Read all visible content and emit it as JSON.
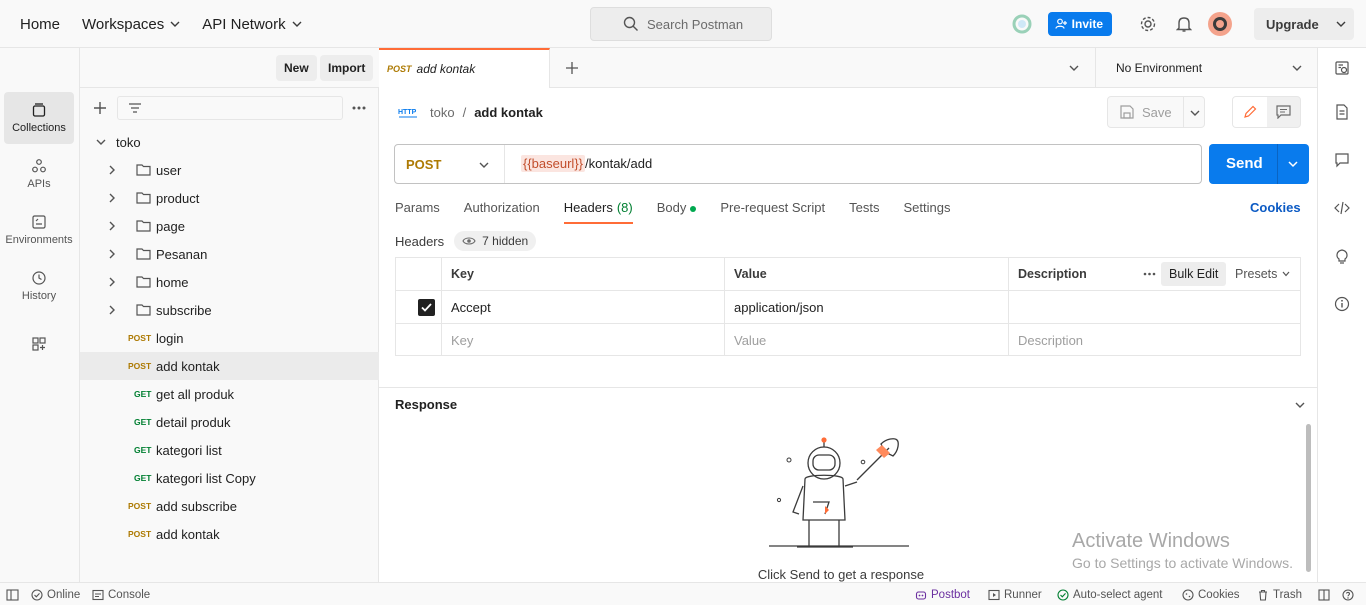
{
  "topbar": {
    "nav": [
      "Home",
      "Workspaces",
      "API Network"
    ],
    "search_placeholder": "Search Postman",
    "invite_label": "Invite",
    "upgrade_label": "Upgrade"
  },
  "workspace": {
    "name": "toko",
    "new_label": "New",
    "import_label": "Import"
  },
  "rail": {
    "items": [
      "Collections",
      "APIs",
      "Environments",
      "History"
    ]
  },
  "tree": {
    "collection": "toko",
    "folders": [
      "user",
      "product",
      "page",
      "Pesanan",
      "home",
      "subscribe"
    ],
    "requests": [
      {
        "method": "POST",
        "name": "login"
      },
      {
        "method": "POST",
        "name": "add kontak"
      },
      {
        "method": "GET",
        "name": "get all produk"
      },
      {
        "method": "GET",
        "name": "detail produk"
      },
      {
        "method": "GET",
        "name": "kategori list"
      },
      {
        "method": "GET",
        "name": "kategori list Copy"
      },
      {
        "method": "POST",
        "name": "add subscribe"
      },
      {
        "method": "POST",
        "name": "add kontak"
      }
    ]
  },
  "tabbar": {
    "active_tab_method": "POST",
    "active_tab_name": "add kontak",
    "environment": "No Environment"
  },
  "request": {
    "breadcrumb_collection": "toko",
    "breadcrumb_sep": "/",
    "breadcrumb_name": "add kontak",
    "http_badge": "HTTP",
    "save_label": "Save",
    "method": "POST",
    "url_var": "{{baseurl}}",
    "url_path": "/kontak/add",
    "send_label": "Send",
    "tabs": {
      "params": "Params",
      "authorization": "Authorization",
      "headers": "Headers",
      "headers_count": "(8)",
      "body": "Body",
      "prerequest": "Pre-request Script",
      "tests": "Tests",
      "settings": "Settings"
    },
    "cookies_label": "Cookies"
  },
  "headers": {
    "title": "Headers",
    "hidden_label": "7 hidden",
    "columns": [
      "Key",
      "Value",
      "Description"
    ],
    "bulk_edit": "Bulk Edit",
    "presets": "Presets",
    "rows": [
      {
        "key": "Accept",
        "value": "application/json",
        "description": "",
        "checked": true
      }
    ],
    "placeholders": {
      "key": "Key",
      "value": "Value",
      "description": "Description"
    }
  },
  "response": {
    "title": "Response",
    "empty_message": "Click Send to get a response"
  },
  "watermark": {
    "line1": "Activate Windows",
    "line2": "Go to Settings to activate Windows."
  },
  "statusbar": {
    "online": "Online",
    "console": "Console",
    "postbot": "Postbot",
    "runner": "Runner",
    "auto_select": "Auto-select agent",
    "cookies": "Cookies",
    "trash": "Trash"
  },
  "colors": {
    "accent_orange": "#ff6c37",
    "primary_blue": "#097bed",
    "post_method": "#ad7a03",
    "get_method": "#007f31"
  }
}
